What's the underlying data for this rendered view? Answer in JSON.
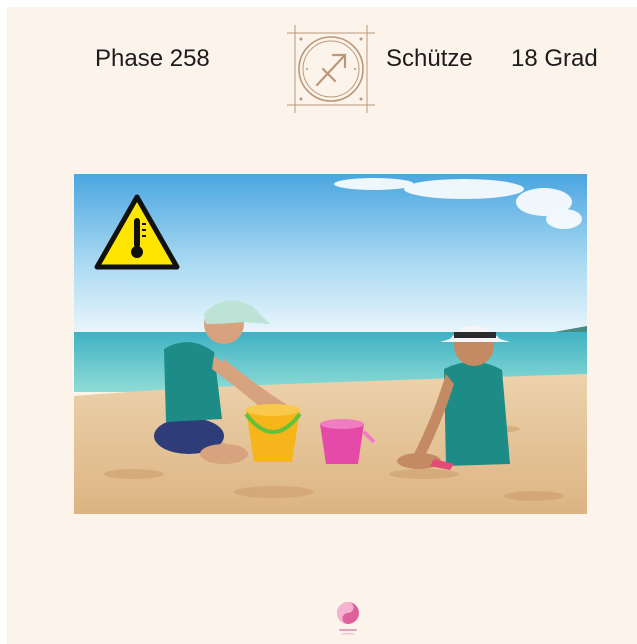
{
  "header": {
    "phase_label": "Phase 258",
    "zodiac_sign": "Schütze",
    "temperature": "18 Grad"
  },
  "icons": {
    "zodiac_icon": "sagittarius-icon",
    "warning_icon": "heat-warning-icon",
    "brand_logo": "brand-logo-icon"
  },
  "photo": {
    "subject": "children-playing-on-beach"
  },
  "colors": {
    "background": "#fcf4ea",
    "zodiac_line": "#b9987a",
    "warning_yellow": "#ffe600",
    "logo_pink": "#e0609c"
  }
}
